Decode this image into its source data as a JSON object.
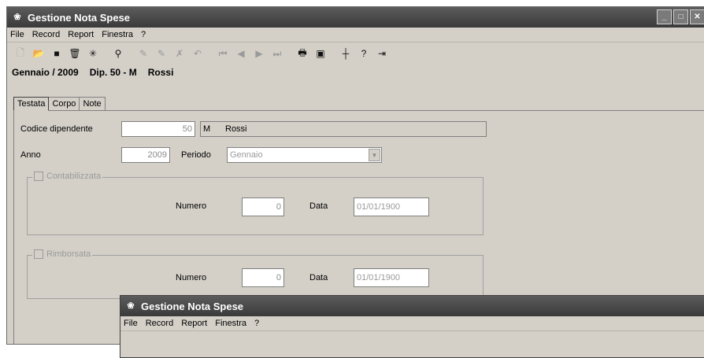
{
  "main_window": {
    "title": "Gestione Nota Spese",
    "menu": [
      "File",
      "Record",
      "Report",
      "Finestra",
      "?"
    ],
    "header": {
      "period": "Gennaio / 2009",
      "dept": "Dip. 50 - M",
      "name": "Rossi"
    },
    "tabs": [
      "Testata",
      "Corpo",
      "Note"
    ],
    "form": {
      "codice_label": "Codice dipendente",
      "codice_value": "50",
      "codice_code": "M",
      "codice_name": "Rossi",
      "anno_label": "Anno",
      "anno_value": "2009",
      "periodo_label": "Periodo",
      "periodo_value": "Gennaio",
      "group1_title": "Contabilizzata",
      "group1_numero_label": "Numero",
      "group1_numero_value": "0",
      "group1_data_label": "Data",
      "group1_data_value": "01/01/1900",
      "group2_title": "Rimborsata",
      "group2_numero_label": "Numero",
      "group2_numero_value": "0",
      "group2_data_label": "Data",
      "group2_data_value": "01/01/1900"
    }
  },
  "second_window": {
    "title": "Gestione Nota Spese",
    "menu": [
      "File",
      "Record",
      "Report",
      "Finestra",
      "?"
    ]
  },
  "icons": {
    "toolbar": [
      "new-file-icon",
      "open-folder-icon",
      "save-icon",
      "delete-icon",
      "asterisk-icon",
      "binoculars-icon",
      "edit-icon",
      "edit-2-icon",
      "edit-3-icon",
      "edit-4-icon",
      "first-record-icon",
      "prev-record-icon",
      "next-record-icon",
      "last-record-icon",
      "print-icon",
      "monitor-icon",
      "crosshair-icon",
      "help-icon",
      "exit-icon"
    ]
  }
}
